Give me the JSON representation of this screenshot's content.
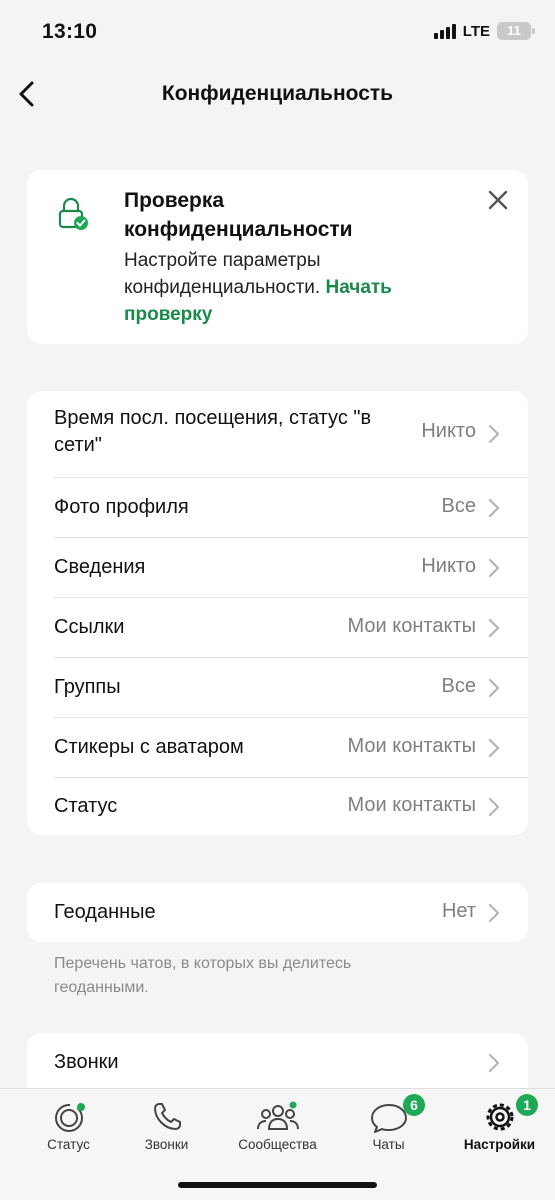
{
  "status_bar": {
    "time": "13:10",
    "network": "LTE",
    "battery": "11"
  },
  "nav": {
    "title": "Конфиденциальность"
  },
  "checkup": {
    "title": "Проверка конфиденциальности",
    "text": "Настройте параметры конфиденциальности.",
    "link": "Начать проверку"
  },
  "privacy": {
    "items": [
      {
        "label": "Время посл. посещения, статус \"в сети\"",
        "value": "Никто"
      },
      {
        "label": "Фото профиля",
        "value": "Все"
      },
      {
        "label": "Сведения",
        "value": "Никто"
      },
      {
        "label": "Ссылки",
        "value": "Мои контакты"
      },
      {
        "label": "Группы",
        "value": "Все"
      },
      {
        "label": "Стикеры с аватаром",
        "value": "Мои контакты"
      },
      {
        "label": "Статус",
        "value": "Мои контакты"
      }
    ]
  },
  "geo": {
    "label": "Геоданные",
    "value": "Нет",
    "hint": "Перечень чатов, в которых вы делитесь геоданными."
  },
  "calls": {
    "label": "Звонки"
  },
  "tabs": [
    {
      "label": "Статус",
      "icon": "status-icon"
    },
    {
      "label": "Звонки",
      "icon": "phone-icon"
    },
    {
      "label": "Сообщества",
      "icon": "communities-icon"
    },
    {
      "label": "Чаты",
      "icon": "chats-icon",
      "badge": "6"
    },
    {
      "label": "Настройки",
      "icon": "settings-icon",
      "badge": "1",
      "active": true
    }
  ],
  "colors": {
    "accent": "#1a8a4a",
    "badge": "#1fa855",
    "background": "#f4f4f4"
  }
}
